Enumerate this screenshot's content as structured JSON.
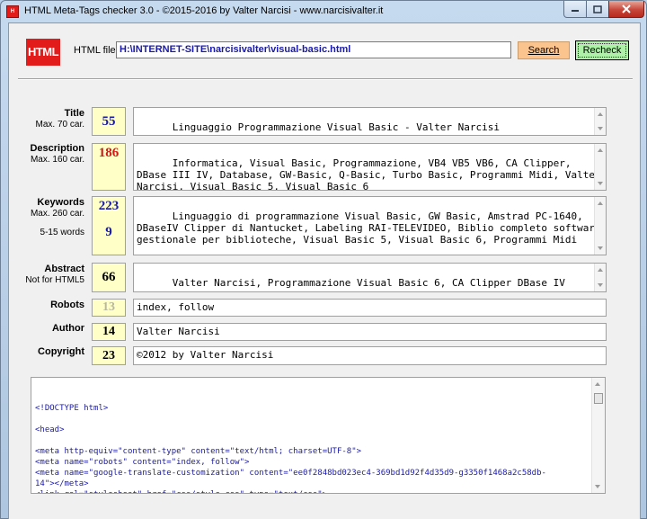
{
  "window": {
    "title": "HTML Meta-Tags checker 3.0 - ©2015-2016 by Valter Narcisi - www.narcisivalter.it",
    "icon_label": "H"
  },
  "header": {
    "logo_text": "HTML",
    "file_label": "HTML file:",
    "file_path": "H:\\INTERNET-SITE\\narcisivalter\\visual-basic.html",
    "search_label": "Search",
    "recheck_label": "Recheck"
  },
  "fields": {
    "title": {
      "label": "Title",
      "sub": "Max. 70 car.",
      "count": "55",
      "count_color": "#1a1aa8",
      "value": "Linguaggio Programmazione Visual Basic - Valter Narcisi"
    },
    "description": {
      "label": "Description",
      "sub": "Max. 160 car.",
      "count": "186",
      "count_color": "#d01818",
      "value": "Informatica, Visual Basic, Programmazione, VB4 VB5 VB6, CA Clipper, DBase III IV, Database, GW-Basic, Q-Basic, Turbo Basic, Programmi Midi, Valter Narcisi, Visual Basic 5, Visual Basic 6"
    },
    "keywords": {
      "label": "Keywords",
      "sub": "Max. 260 car.",
      "sub2": "5-15 words",
      "count": "223",
      "word_count": "9",
      "count_color": "#1a1aa8",
      "value": "Linguaggio di programmazione Visual Basic, GW Basic, Amstrad PC-1640, DBaseIV Clipper di Nantucket, Labeling RAI-TELEVIDEO, Biblio completo software gestionale per biblioteche, Visual Basic 5, Visual Basic 6, Programmi Midi"
    },
    "abstract": {
      "label": "Abstract",
      "sub": "Not for HTML5",
      "count": "66",
      "count_color": "#000000",
      "value": "Valter Narcisi, Programmazione Visual Basic 6, CA Clipper DBase IV"
    },
    "robots": {
      "label": "Robots",
      "count": "13",
      "count_color": "#b8b8a0",
      "value": "index, follow"
    },
    "author": {
      "label": "Author",
      "count": "14",
      "count_color": "#000000",
      "value": "Valter Narcisi"
    },
    "copyright": {
      "label": "Copyright",
      "count": "23",
      "count_color": "#000000",
      "value": "©2012 by Valter Narcisi"
    }
  },
  "source": {
    "lines": [
      "<!DOCTYPE html>",
      "",
      "<head>",
      "",
      "<meta http-equiv=\"content-type\" content=\"text/html; charset=UTF-8\">",
      "<meta name=\"robots\" content=\"index, follow\">",
      "<meta name=\"google-translate-customization\" content=\"ee0f2848bd023ec4-369bd1d92f4d35d9-g3350f1468a2c58db-",
      "14\"></meta>",
      "<link rel=\"stylesheet\" href=\"css/style.css\" type=\"text/css\">"
    ]
  }
}
